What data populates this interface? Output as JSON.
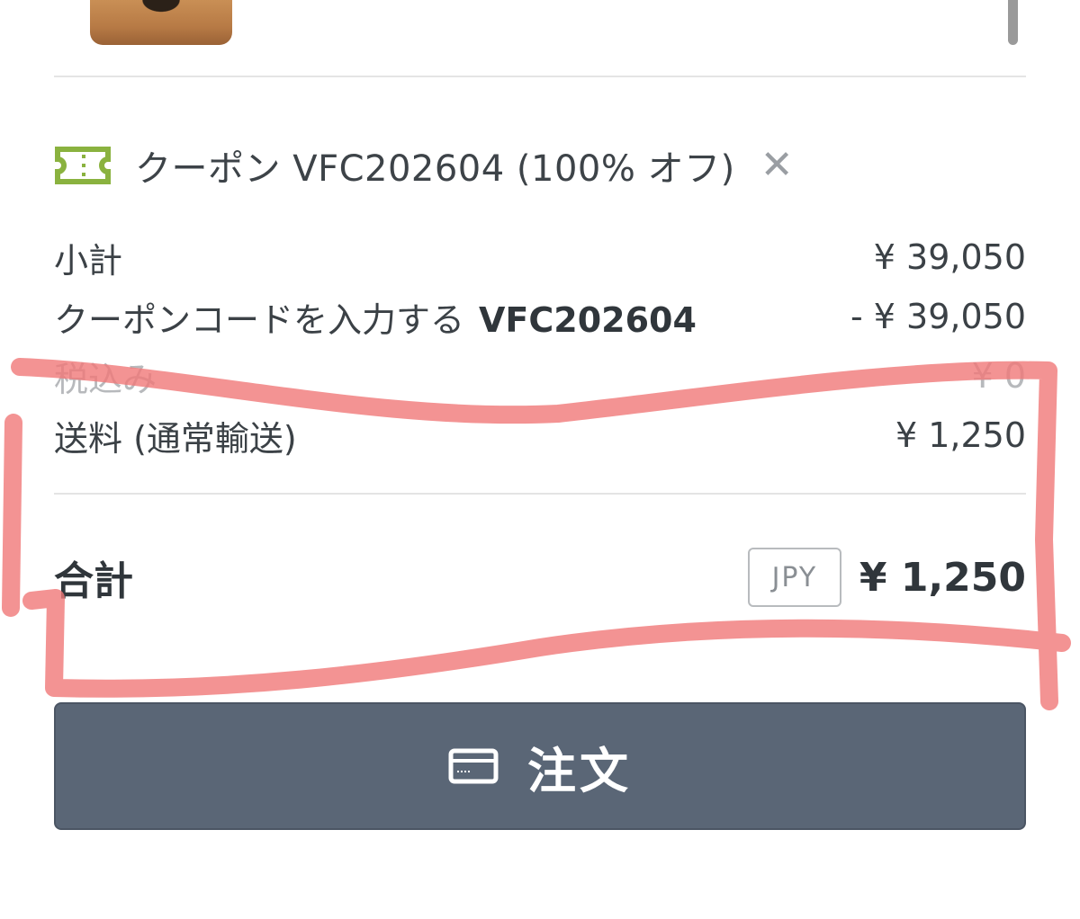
{
  "coupon": {
    "label": "クーポン VFC202604 (100% オフ)",
    "remove": "✕"
  },
  "summary": {
    "subtotal_label": "小計",
    "subtotal_value": "¥ 39,050",
    "coupon_label": "クーポンコードを入力する",
    "coupon_code": "VFC202604",
    "coupon_value": "- ¥ 39,050",
    "tax_label": "税込み",
    "tax_value": "¥ 0",
    "shipping_label": "送料 (通常輸送)",
    "shipping_value": "¥ 1,250"
  },
  "total": {
    "label": "合計",
    "currency": "JPY",
    "value": "¥ 1,250"
  },
  "order_button": {
    "label": "注文",
    "icon": "credit-card-icon"
  },
  "colors": {
    "coupon_icon": "#8ab23f",
    "button_bg": "#5a6676",
    "annotation": "#f07878"
  }
}
